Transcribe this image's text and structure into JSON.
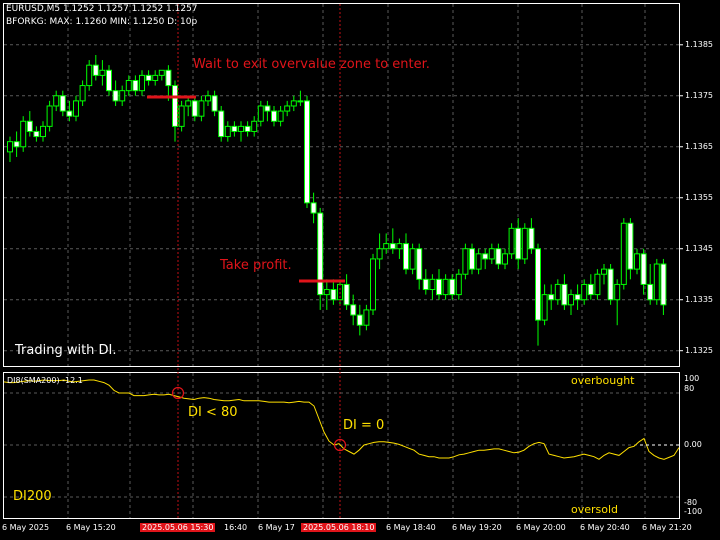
{
  "header": {
    "symbol_line": "EURUSD,M5  1.1252 1.1257 1.1252 1.1257",
    "indicator_line": "BFORKG: MAX: 1.1260 MIN: 1.1250 D: 10p"
  },
  "price_axis": [
    "1.1385",
    "1.1375",
    "1.1365",
    "1.1355",
    "1.1345",
    "1.1335",
    "1.1325"
  ],
  "annotations": {
    "wait_text": "Wait to exit overvalue zone to enter.",
    "take_profit": "Take profit.",
    "trading_with": "Trading with DI.",
    "di_lt_80": "DI < 80",
    "di_eq_0": "DI = 0",
    "di200": "DI200",
    "overbought": "overbought",
    "oversold": "oversold"
  },
  "indicator": {
    "label": "DI8(SMA200) -12.1",
    "axis": [
      "100",
      "80",
      "0.00",
      "-80",
      "-100"
    ],
    "series": [
      97,
      96,
      96,
      97,
      98,
      99,
      98,
      99,
      100,
      99,
      99,
      99,
      100,
      98,
      97,
      98,
      99,
      100,
      100,
      98,
      96,
      92,
      84,
      80,
      80,
      80,
      76,
      76,
      76,
      77,
      78,
      77,
      77,
      78,
      76,
      74,
      72,
      71,
      70,
      72,
      73,
      72,
      70,
      69,
      68,
      68,
      69,
      70,
      68,
      68,
      68,
      68,
      67,
      66,
      66,
      66,
      66,
      65,
      66,
      67,
      66,
      66,
      60,
      40,
      20,
      6,
      0,
      2,
      -6,
      -10,
      -14,
      -8,
      0,
      2,
      4,
      5,
      5,
      4,
      3,
      1,
      -2,
      -5,
      -8,
      -14,
      -16,
      -18,
      -18,
      -20,
      -20,
      -20,
      -18,
      -15,
      -14,
      -12,
      -10,
      -8,
      -8,
      -7,
      -6,
      -6,
      -8,
      -10,
      -12,
      -11,
      -8,
      -2,
      2,
      4,
      2,
      -14,
      -16,
      -18,
      -20,
      -19,
      -18,
      -16,
      -14,
      -16,
      -18,
      -22,
      -16,
      -12,
      -14,
      -16,
      -10,
      -4,
      -2,
      5,
      10,
      -10,
      -16,
      -20,
      -22,
      -19,
      -16,
      -4
    ]
  },
  "time_axis": [
    {
      "label": "6 May 2025",
      "highlight": false
    },
    {
      "label": "6 May 15:20",
      "highlight": false
    },
    {
      "label": "2025.05.06 15:30",
      "highlight": true
    },
    {
      "label": "16:40",
      "highlight": false
    },
    {
      "label": "6 May 17",
      "highlight": false
    },
    {
      "label": "2025.05.06 18:10",
      "highlight": true
    },
    {
      "label": "6 May 18:40",
      "highlight": false
    },
    {
      "label": "6 May 19:20",
      "highlight": false
    },
    {
      "label": "6 May 20:00",
      "highlight": false
    },
    {
      "label": "6 May 20:40",
      "highlight": false
    },
    {
      "label": "6 May 21:20",
      "highlight": false
    }
  ],
  "chart_data": {
    "type": "candlestick",
    "symbol": "EURUSD",
    "timeframe": "M5",
    "ylim": [
      1.1322,
      1.1393
    ],
    "candles": [
      [
        1.1364,
        1.1367,
        1.1362,
        1.1366
      ],
      [
        1.1366,
        1.1368,
        1.1363,
        1.1365
      ],
      [
        1.1365,
        1.1371,
        1.1364,
        1.137
      ],
      [
        1.137,
        1.1372,
        1.1367,
        1.1368
      ],
      [
        1.1368,
        1.1369,
        1.1366,
        1.1367
      ],
      [
        1.1367,
        1.137,
        1.1366,
        1.1369
      ],
      [
        1.1369,
        1.1374,
        1.1368,
        1.1373
      ],
      [
        1.1373,
        1.1376,
        1.1372,
        1.1375
      ],
      [
        1.1375,
        1.1376,
        1.1371,
        1.1372
      ],
      [
        1.1372,
        1.1374,
        1.137,
        1.1371
      ],
      [
        1.1371,
        1.1375,
        1.137,
        1.1374
      ],
      [
        1.1374,
        1.1378,
        1.1373,
        1.1377
      ],
      [
        1.1377,
        1.1382,
        1.1376,
        1.1381
      ],
      [
        1.1381,
        1.1383,
        1.1378,
        1.1379
      ],
      [
        1.1379,
        1.1382,
        1.1377,
        1.138
      ],
      [
        1.138,
        1.1381,
        1.1375,
        1.1376
      ],
      [
        1.1376,
        1.1378,
        1.1373,
        1.1374
      ],
      [
        1.1374,
        1.1377,
        1.1373,
        1.1376
      ],
      [
        1.1376,
        1.1379,
        1.1375,
        1.1378
      ],
      [
        1.1378,
        1.1379,
        1.1375,
        1.1376
      ],
      [
        1.1376,
        1.138,
        1.1375,
        1.1379
      ],
      [
        1.1379,
        1.138,
        1.1377,
        1.1378
      ],
      [
        1.1378,
        1.138,
        1.1377,
        1.1379
      ],
      [
        1.1379,
        1.138,
        1.1378,
        1.138
      ],
      [
        1.138,
        1.1381,
        1.1374,
        1.1377
      ],
      [
        1.1377,
        1.1378,
        1.1366,
        1.1369
      ],
      [
        1.1369,
        1.1374,
        1.1368,
        1.1373
      ],
      [
        1.1373,
        1.1375,
        1.1371,
        1.1374
      ],
      [
        1.1374,
        1.1375,
        1.137,
        1.1371
      ],
      [
        1.1371,
        1.1375,
        1.137,
        1.1374
      ],
      [
        1.1374,
        1.1376,
        1.1373,
        1.1375
      ],
      [
        1.1375,
        1.1376,
        1.1371,
        1.1372
      ],
      [
        1.1372,
        1.1373,
        1.1366,
        1.1367
      ],
      [
        1.1367,
        1.137,
        1.1366,
        1.1369
      ],
      [
        1.1369,
        1.137,
        1.1367,
        1.1368
      ],
      [
        1.1368,
        1.137,
        1.1366,
        1.1369
      ],
      [
        1.1369,
        1.137,
        1.1367,
        1.1368
      ],
      [
        1.1368,
        1.1371,
        1.1367,
        1.137
      ],
      [
        1.137,
        1.1374,
        1.1369,
        1.1373
      ],
      [
        1.1373,
        1.1374,
        1.137,
        1.1372
      ],
      [
        1.1372,
        1.1373,
        1.1369,
        1.137
      ],
      [
        1.137,
        1.1373,
        1.1369,
        1.1372
      ],
      [
        1.1372,
        1.1374,
        1.1371,
        1.1373
      ],
      [
        1.1373,
        1.1375,
        1.1372,
        1.1374
      ],
      [
        1.1374,
        1.1376,
        1.1373,
        1.1374
      ],
      [
        1.1374,
        1.1375,
        1.1353,
        1.1354
      ],
      [
        1.1354,
        1.1356,
        1.135,
        1.1352
      ],
      [
        1.1352,
        1.1353,
        1.1333,
        1.1336
      ],
      [
        1.1336,
        1.1339,
        1.1333,
        1.1337
      ],
      [
        1.1337,
        1.1339,
        1.1334,
        1.1335
      ],
      [
        1.1335,
        1.1339,
        1.1334,
        1.1338
      ],
      [
        1.1338,
        1.134,
        1.1333,
        1.1334
      ],
      [
        1.1334,
        1.1336,
        1.133,
        1.1332
      ],
      [
        1.1332,
        1.1334,
        1.1328,
        1.133
      ],
      [
        1.133,
        1.1334,
        1.1329,
        1.1333
      ],
      [
        1.1333,
        1.1344,
        1.1332,
        1.1343
      ],
      [
        1.1343,
        1.1348,
        1.1341,
        1.1345
      ],
      [
        1.1345,
        1.1348,
        1.1344,
        1.1346
      ],
      [
        1.1346,
        1.1349,
        1.1344,
        1.1345
      ],
      [
        1.1345,
        1.1347,
        1.1343,
        1.1346
      ],
      [
        1.1346,
        1.1348,
        1.134,
        1.1341
      ],
      [
        1.1341,
        1.1346,
        1.134,
        1.1345
      ],
      [
        1.1345,
        1.1346,
        1.1337,
        1.1339
      ],
      [
        1.1339,
        1.1341,
        1.1336,
        1.1337
      ],
      [
        1.1337,
        1.134,
        1.1335,
        1.1339
      ],
      [
        1.1339,
        1.1341,
        1.1335,
        1.1336
      ],
      [
        1.1336,
        1.134,
        1.1335,
        1.1339
      ],
      [
        1.1339,
        1.134,
        1.1335,
        1.1336
      ],
      [
        1.1336,
        1.1341,
        1.1335,
        1.134
      ],
      [
        1.134,
        1.1346,
        1.1339,
        1.1345
      ],
      [
        1.1345,
        1.1346,
        1.134,
        1.1341
      ],
      [
        1.1341,
        1.1345,
        1.134,
        1.1344
      ],
      [
        1.1344,
        1.1345,
        1.1341,
        1.1343
      ],
      [
        1.1343,
        1.1346,
        1.1342,
        1.1345
      ],
      [
        1.1345,
        1.1346,
        1.1341,
        1.1342
      ],
      [
        1.1342,
        1.1345,
        1.1341,
        1.1344
      ],
      [
        1.1344,
        1.135,
        1.1343,
        1.1349
      ],
      [
        1.1349,
        1.1351,
        1.1341,
        1.1343
      ],
      [
        1.1343,
        1.135,
        1.1342,
        1.1349
      ],
      [
        1.1349,
        1.1351,
        1.1344,
        1.1345
      ],
      [
        1.1345,
        1.1346,
        1.1326,
        1.1331
      ],
      [
        1.1331,
        1.1338,
        1.133,
        1.1336
      ],
      [
        1.1336,
        1.1338,
        1.1333,
        1.1335
      ],
      [
        1.1335,
        1.1339,
        1.1334,
        1.1338
      ],
      [
        1.1338,
        1.134,
        1.1333,
        1.1334
      ],
      [
        1.1334,
        1.1337,
        1.1332,
        1.1336
      ],
      [
        1.1336,
        1.1338,
        1.1333,
        1.1335
      ],
      [
        1.1335,
        1.1339,
        1.1334,
        1.1338
      ],
      [
        1.1338,
        1.134,
        1.1335,
        1.1336
      ],
      [
        1.1336,
        1.1341,
        1.1335,
        1.134
      ],
      [
        1.134,
        1.1342,
        1.1338,
        1.1341
      ],
      [
        1.1341,
        1.1342,
        1.1334,
        1.1335
      ],
      [
        1.1335,
        1.1339,
        1.133,
        1.1338
      ],
      [
        1.1338,
        1.1351,
        1.1337,
        1.135
      ],
      [
        1.135,
        1.1351,
        1.1339,
        1.1341
      ],
      [
        1.1341,
        1.1345,
        1.134,
        1.1344
      ],
      [
        1.1344,
        1.1345,
        1.1336,
        1.1338
      ],
      [
        1.1338,
        1.1342,
        1.1334,
        1.1335
      ],
      [
        1.1335,
        1.1343,
        1.1334,
        1.1342
      ],
      [
        1.1342,
        1.1343,
        1.1332,
        1.1334
      ]
    ]
  }
}
